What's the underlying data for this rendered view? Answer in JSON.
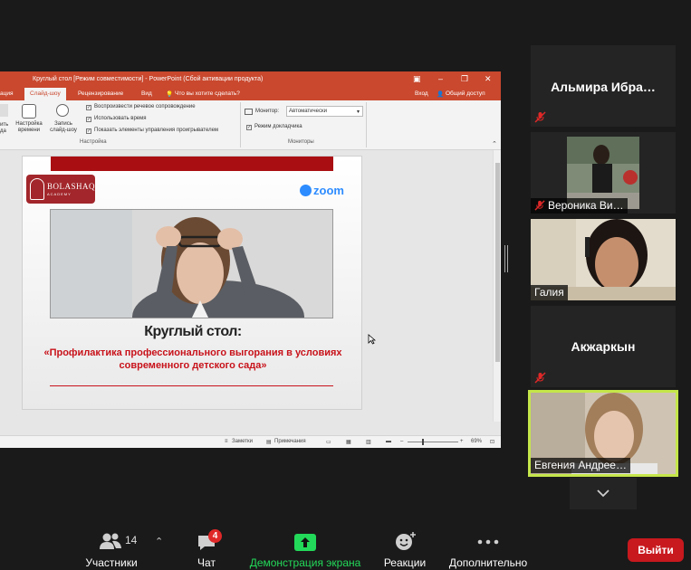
{
  "ppt": {
    "window_title": "Круглый стол [Режим совместимости] - PowerPoint (Сбой активации продукта)",
    "tabs": [
      "ация",
      "Слайд-шоу",
      "Рецензирование",
      "Вид",
      "Что вы хотите сделать?"
    ],
    "tab_active": "Слайд-шоу",
    "signin": "Вход",
    "share": "Общий доступ",
    "ribbon": {
      "btn_cut": "ить\nда",
      "btn_settings": "Настройка\nвремени",
      "btn_record": "Запись\nслайд-шоу",
      "check_narration": "Воспроизвести речевое сопровождение",
      "check_timing": "Использовать время",
      "check_controls": "Показать элементы управления проигрывателем",
      "group_setup": "Настройка",
      "monitor_label": "Монитор:",
      "monitor_value": "Автоматически",
      "presenter_view": "Режим докладчика",
      "group_monitors": "Мониторы"
    },
    "status": {
      "notes": "Заметки",
      "comments": "Примечания",
      "zoom": "69%"
    }
  },
  "slide": {
    "logo_name": "BOLASHAQ",
    "logo_sub": "ACADEMY",
    "zoom_brand": "zoom",
    "title": "Круглый стол:",
    "subtitle": "«Профилактика профессионального выгорания в условиях современного детского сада»"
  },
  "participants": [
    {
      "name": "Альмира  Ибра…",
      "muted": true,
      "video": false
    },
    {
      "name": "Вероника Ви…",
      "muted": true,
      "video": true
    },
    {
      "name": "Галия",
      "muted": false,
      "video": true
    },
    {
      "name": "Акжаркын",
      "muted": true,
      "video": false
    },
    {
      "name": "Евгения Андрее…",
      "muted": false,
      "video": true,
      "speaking": true
    }
  ],
  "toolbar": {
    "participants_label": "Участники",
    "participants_count": "14",
    "chat_label": "Чат",
    "chat_badge": "4",
    "share_label": "Демонстрация экрана",
    "reactions_label": "Реакции",
    "more_label": "Дополнительно",
    "leave_label": "Выйти"
  },
  "colors": {
    "ppt_accent": "#c9482e",
    "share_green": "#23d959",
    "leave_red": "#c8191e",
    "active_speaker": "#c5e64a",
    "slide_red": "#c8121a"
  }
}
